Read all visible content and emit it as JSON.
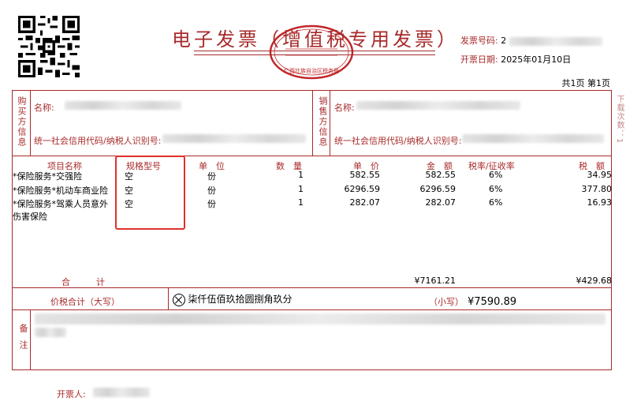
{
  "header": {
    "title": "电子发票（增值税专用发票）",
    "invoice_number_label": "发票号码:",
    "invoice_number_value": "2",
    "issue_date_label": "开票日期:",
    "issue_date_value": "2025年01月10日",
    "pages": "共1页  第1页",
    "side_note": "下载次数：1",
    "seal_text": "广西壮族自治区税务局"
  },
  "buyer": {
    "section_label": "购买方信息",
    "name_label": "名称:",
    "name_value": "",
    "tax_id_label": "统一社会信用代码/纳税人识别号:"
  },
  "seller": {
    "section_label": "销售方信息",
    "name_label": "名称:",
    "tax_id_label": "统一社会信用代码/纳税人识别号:"
  },
  "items_table": {
    "headers": {
      "name": "项目名称",
      "spec": "规格型号",
      "unit": "单　位",
      "qty": "数　量",
      "price": "单　价",
      "amount": "金　额",
      "rate": "税率/征收率",
      "tax": "税　额"
    },
    "rows": [
      {
        "name": "*保险服务*交强险",
        "spec": "空",
        "unit": "份",
        "qty": "1",
        "price": "582.55",
        "amount": "582.55",
        "rate": "6%",
        "tax": "34.95"
      },
      {
        "name": "*保险服务*机动车商业险",
        "spec": "空",
        "unit": "份",
        "qty": "1",
        "price": "6296.59",
        "amount": "6296.59",
        "rate": "6%",
        "tax": "377.80"
      },
      {
        "name": "*保险服务*驾乘人员意外",
        "spec": "空",
        "unit": "份",
        "qty": "1",
        "price": "282.07",
        "amount": "282.07",
        "rate": "6%",
        "tax": "16.93"
      }
    ],
    "row3_continued": "伤害保险",
    "total_label": "合　　　计",
    "total_amount": "¥7161.21",
    "total_tax": "¥429.68"
  },
  "grand_total": {
    "label": "价税合计（大写）",
    "words": "柒仟伍佰玖拾圆捌角玖分",
    "small_label": "（小写）",
    "small_value": "¥7590.89"
  },
  "remarks": {
    "label": "备注"
  },
  "footer": {
    "issuer_label": "开票人:"
  }
}
